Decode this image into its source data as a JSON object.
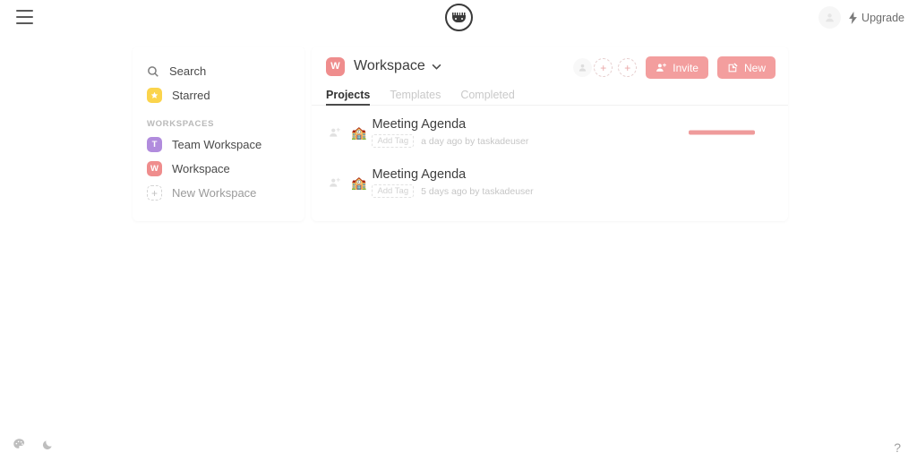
{
  "topbar": {
    "menu_icon": "hamburger-icon",
    "logo_icon": "taskade-logo-icon",
    "avatar_icon": "user-avatar-icon",
    "upgrade_label": "Upgrade",
    "upgrade_icon": "lightning-bolt-icon"
  },
  "sidebar": {
    "search": {
      "label": "Search",
      "icon": "search-icon"
    },
    "starred": {
      "label": "Starred",
      "icon": "star-icon"
    },
    "section_label": "WORKSPACES",
    "workspaces": [
      {
        "label": "Team Workspace",
        "initial": "T",
        "color": "#b18cdd"
      },
      {
        "label": "Workspace",
        "initial": "W",
        "color": "#ef8d8d"
      }
    ],
    "new_workspace": {
      "label": "New Workspace",
      "icon": "plus-icon"
    }
  },
  "main": {
    "workspace_initial": "W",
    "workspace_title": "Workspace",
    "chevron_icon": "chevron-down-icon",
    "member_add_icon": "plus-icon",
    "invite": {
      "label": "Invite",
      "icon": "person-plus-icon"
    },
    "new": {
      "label": "New",
      "icon": "edit-square-icon"
    },
    "tabs": [
      {
        "label": "Projects",
        "active": true
      },
      {
        "label": "Templates",
        "active": false
      },
      {
        "label": "Completed",
        "active": false
      }
    ],
    "rows": [
      {
        "emoji": "🏫",
        "title": "Meeting Agenda",
        "tag_label": "Add Tag",
        "meta": "a day ago by taskadeuser",
        "add_member_icon": "person-plus-icon",
        "has_bar": true
      },
      {
        "emoji": "🏫",
        "title": "Meeting Agenda",
        "tag_label": "Add Tag",
        "meta": "5 days ago by taskadeuser",
        "add_member_icon": "person-plus-icon",
        "has_bar": false
      }
    ]
  },
  "footer": {
    "theme_icon": "palette-icon",
    "dark_mode_icon": "moon-icon",
    "help_label": "?"
  },
  "colors": {
    "accent": "#ef8d8d",
    "accent_button": "#f39e9e",
    "star": "#fbd44c",
    "team": "#b18cdd"
  }
}
